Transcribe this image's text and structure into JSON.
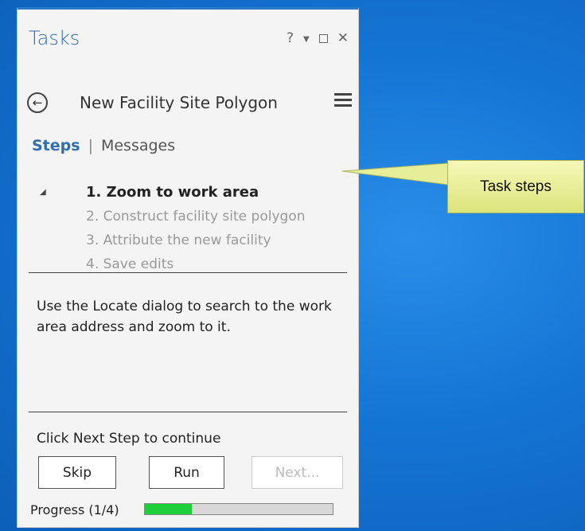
{
  "pane": {
    "title": "Tasks",
    "help_glyph": "?",
    "dropdown_glyph": "▼",
    "close_glyph": "✕",
    "back_glyph": "←",
    "task_title": "New Facility Site Polygon"
  },
  "tabs": {
    "steps": "Steps",
    "separator": "|",
    "messages": "Messages"
  },
  "collapse_glyph": "◢",
  "steps": [
    {
      "label": "1. Zoom to work area",
      "active": true
    },
    {
      "label": "2. Construct facility site polygon",
      "active": false
    },
    {
      "label": "3. Attribute the new facility",
      "active": false
    },
    {
      "label": "4. Save edits",
      "active": false
    }
  ],
  "description": "Use the Locate dialog to search to the work area address and zoom to it.",
  "hint": "Click Next Step to continue",
  "buttons": {
    "skip": "Skip",
    "run": "Run",
    "next": "Next..."
  },
  "progress": {
    "label": "Progress (1/4)",
    "value": 0.25
  },
  "callout": {
    "text": "Task steps"
  },
  "colors": {
    "accent": "#2f6db5",
    "progress": "#1fcf3a",
    "callout": "#eef29a"
  }
}
